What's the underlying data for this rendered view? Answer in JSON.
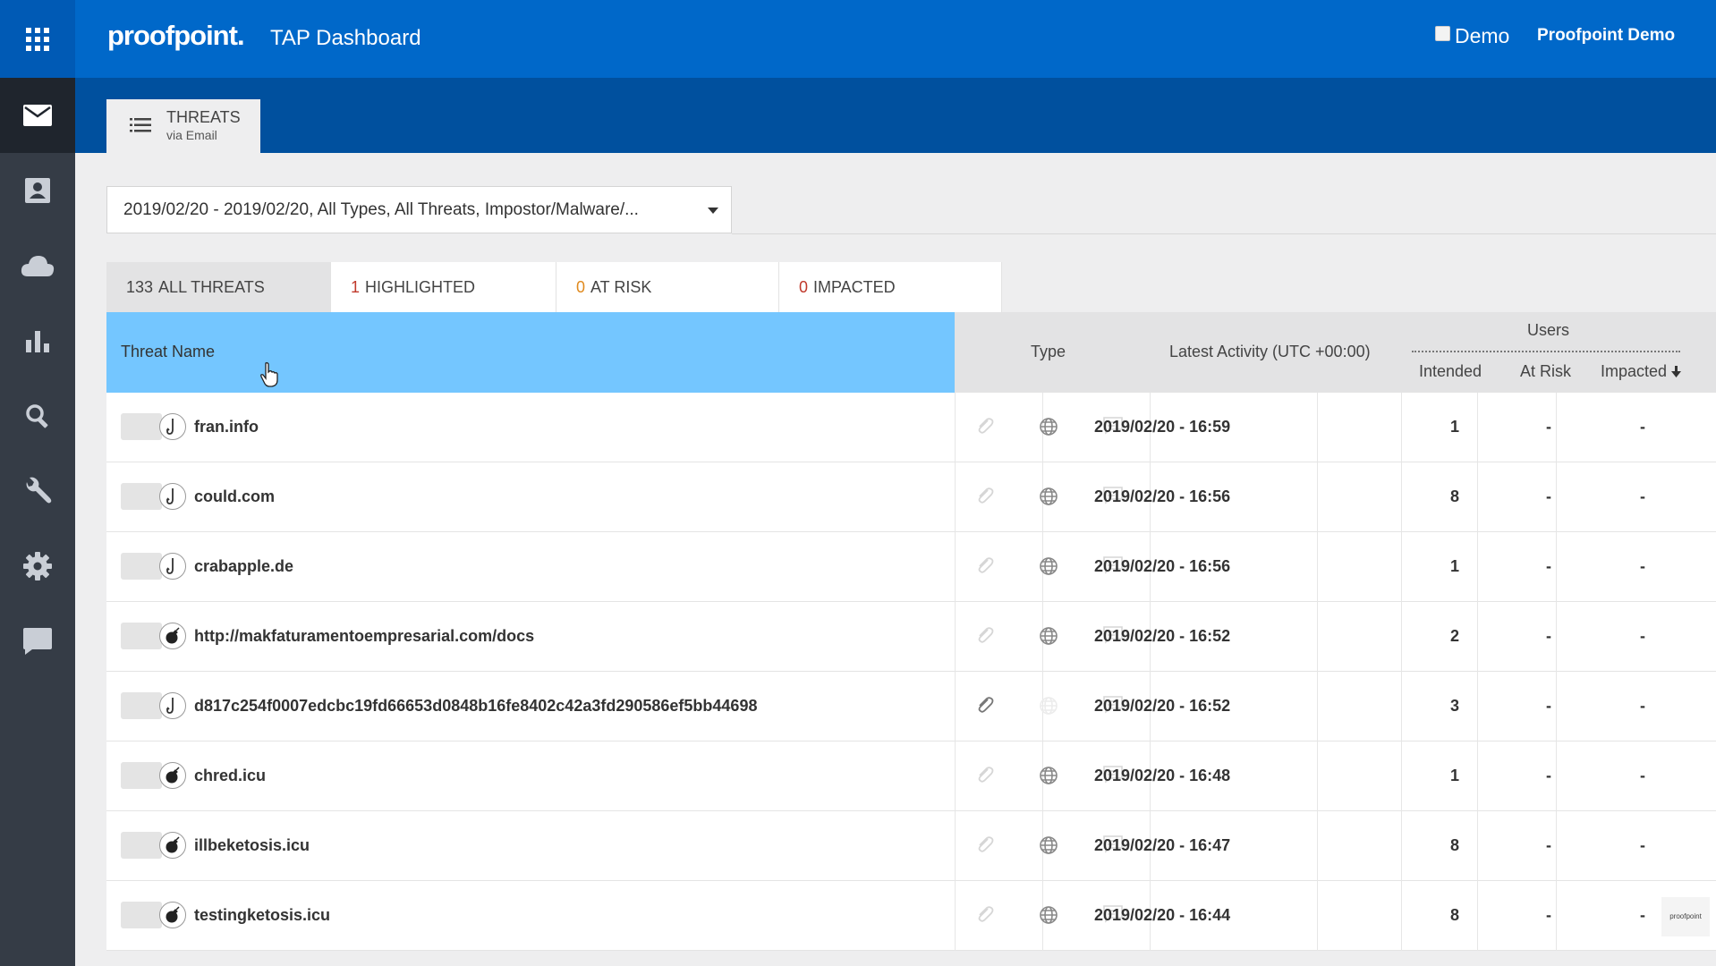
{
  "header": {
    "logo": "proofpoint.",
    "title": "TAP Dashboard",
    "demo_label": "Demo",
    "user": "Proofpoint Demo"
  },
  "sidebar": {
    "items": [
      {
        "icon": "apps-grid-icon"
      },
      {
        "icon": "mail-icon",
        "active": true
      },
      {
        "icon": "contact-card-icon"
      },
      {
        "icon": "cloud-icon"
      },
      {
        "icon": "bar-chart-icon"
      },
      {
        "icon": "search-icon"
      },
      {
        "icon": "wrench-icon"
      },
      {
        "icon": "gear-icon"
      },
      {
        "icon": "chat-icon"
      }
    ]
  },
  "subnav": {
    "tab_title": "THREATS",
    "tab_subtitle": "via Email"
  },
  "filter": {
    "value": "2019/02/20 - 2019/02/20, All Types, All Threats, Impostor/Malware/..."
  },
  "count_tabs": [
    {
      "count": "133",
      "label": "ALL THREATS",
      "selected": true
    },
    {
      "count": "1",
      "label": "HIGHLIGHTED"
    },
    {
      "count": "0",
      "label": "AT RISK"
    },
    {
      "count": "0",
      "label": "IMPACTED"
    }
  ],
  "table": {
    "headers": {
      "threat_name": "Threat Name",
      "type": "Type",
      "latest_activity": "Latest Activity (UTC +00:00)",
      "users": "Users",
      "intended": "Intended",
      "at_risk": "At Risk",
      "impacted": "Impacted"
    },
    "rows": [
      {
        "kind": "phish-hook-icon",
        "name": "fran.info",
        "activity": "2019/02/20 - 16:59",
        "intended": "1",
        "at_risk": "-",
        "impacted": "-",
        "attachment_active": false,
        "url_active": true
      },
      {
        "kind": "phish-hook-icon",
        "name": "could.com",
        "activity": "2019/02/20 - 16:56",
        "intended": "8",
        "at_risk": "-",
        "impacted": "-",
        "attachment_active": false,
        "url_active": true
      },
      {
        "kind": "phish-hook-icon",
        "name": "crabapple.de",
        "activity": "2019/02/20 - 16:56",
        "intended": "1",
        "at_risk": "-",
        "impacted": "-",
        "attachment_active": false,
        "url_active": true
      },
      {
        "kind": "malware-bomb-icon",
        "name": "http://makfaturamentoempresarial.com/docs",
        "activity": "2019/02/20 - 16:52",
        "intended": "2",
        "at_risk": "-",
        "impacted": "-",
        "attachment_active": false,
        "url_active": true
      },
      {
        "kind": "phish-hook-icon",
        "name": "d817c254f0007edcbc19fd66653d0848b16fe8402c42a3fd290586ef5bb44698",
        "activity": "2019/02/20 - 16:52",
        "intended": "3",
        "at_risk": "-",
        "impacted": "-",
        "attachment_active": true,
        "url_active": false
      },
      {
        "kind": "malware-bomb-icon",
        "name": "chred.icu",
        "activity": "2019/02/20 - 16:48",
        "intended": "1",
        "at_risk": "-",
        "impacted": "-",
        "attachment_active": false,
        "url_active": true
      },
      {
        "kind": "malware-bomb-icon",
        "name": "illbeketosis.icu",
        "activity": "2019/02/20 - 16:47",
        "intended": "8",
        "at_risk": "-",
        "impacted": "-",
        "attachment_active": false,
        "url_active": true
      },
      {
        "kind": "malware-bomb-icon",
        "name": "testingketosis.icu",
        "activity": "2019/02/20 - 16:44",
        "intended": "8",
        "at_risk": "-",
        "impacted": "-",
        "attachment_active": false,
        "url_active": true
      }
    ]
  },
  "watermark": "proofpoint"
}
